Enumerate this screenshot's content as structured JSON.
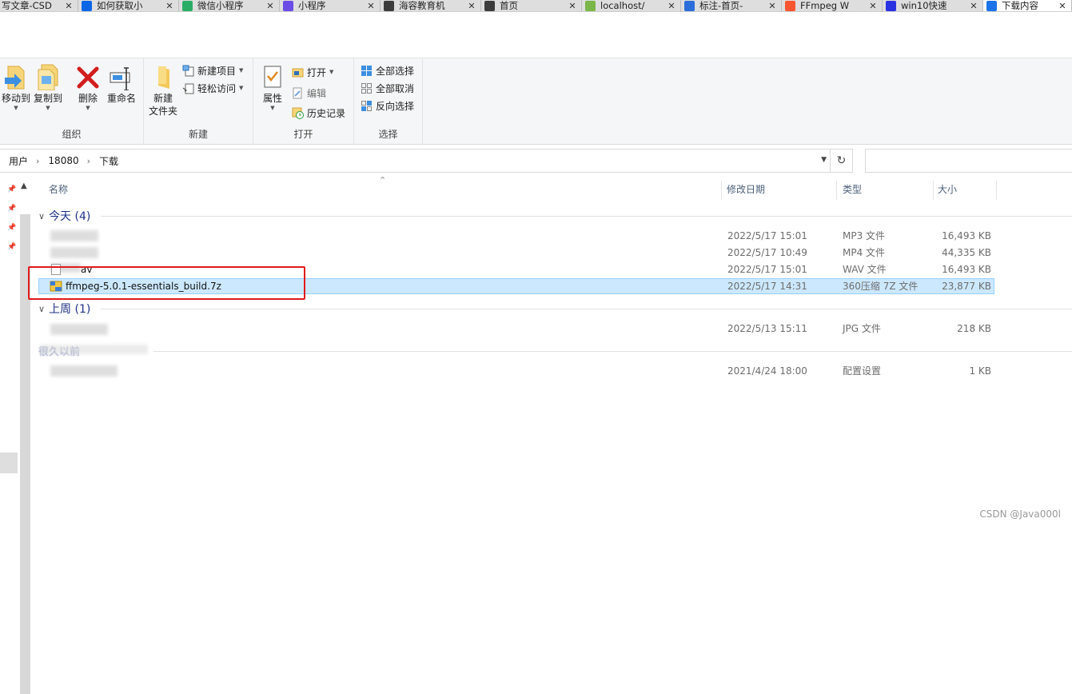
{
  "browser_tabs": [
    {
      "label": "写文章-CSD",
      "icon": "csdn-write-icon",
      "icon_color": "#c8c8c8"
    },
    {
      "label": "如何获取小",
      "icon": "zhihu-icon",
      "icon_color": "#0a66e4"
    },
    {
      "label": "微信小程序",
      "icon": "wechat-icon",
      "icon_color": "#2aae67"
    },
    {
      "label": "小程序",
      "icon": "miniprogram-icon",
      "icon_color": "#6b4ce6"
    },
    {
      "label": "海容教育机",
      "icon": "globe-icon",
      "icon_color": "#3c3c3c"
    },
    {
      "label": "首页",
      "icon": "globe-icon",
      "icon_color": "#3c3c3c"
    },
    {
      "label": "localhost/",
      "icon": "leaf-icon",
      "icon_color": "#7ab648"
    },
    {
      "label": "标注-首页-",
      "icon": "mark-icon",
      "icon_color": "#2b6ed9"
    },
    {
      "label": "FFmpeg W",
      "icon": "csdn-icon",
      "icon_color": "#fc5531"
    },
    {
      "label": "win10快速",
      "icon": "baidu-paw-icon",
      "icon_color": "#2932e1"
    },
    {
      "label": "下载内容",
      "icon": "download-icon",
      "icon_color": "#1a73e8",
      "active": true
    }
  ],
  "tab_close_glyph": "✕",
  "ribbon": {
    "organize": {
      "label": "组织",
      "move_to": "移动到",
      "copy_to": "复制到",
      "delete": "删除",
      "rename": "重命名"
    },
    "new": {
      "label": "新建",
      "new_folder_line1": "新建",
      "new_folder_line2": "文件夹",
      "new_item": "新建项目",
      "easy_access": "轻松访问"
    },
    "open": {
      "label": "打开",
      "properties": "属性",
      "open": "打开",
      "edit": "编辑",
      "history": "历史记录"
    },
    "select": {
      "label": "选择",
      "select_all": "全部选择",
      "select_none": "全部取消",
      "invert_selection": "反向选择"
    }
  },
  "address": {
    "crumbs": [
      "用户",
      "18080",
      "下载"
    ],
    "separator": "›"
  },
  "columns": {
    "name": "名称",
    "date": "修改日期",
    "type": "类型",
    "size": "大小"
  },
  "groups": [
    {
      "label": "今天 (4)"
    },
    {
      "label": "上周 (1)"
    }
  ],
  "rows": [
    {
      "name": "",
      "date": "2022/5/17 15:01",
      "type": "MP3 文件",
      "size": "16,493 KB"
    },
    {
      "name": "",
      "date": "2022/5/17 10:49",
      "type": "MP4 文件",
      "size": "44,335 KB"
    },
    {
      "name": "av",
      "date": "2022/5/17 15:01",
      "type": "WAV 文件",
      "size": "16,493 KB"
    },
    {
      "name": "ffmpeg-5.0.1-essentials_build.7z",
      "date": "2022/5/17 14:31",
      "type": "360压缩 7Z 文件",
      "size": "23,877 KB",
      "selected": true
    },
    {
      "name": "",
      "date": "2022/5/13 15:11",
      "type": "JPG 文件",
      "size": "218 KB"
    },
    {
      "name": "",
      "date": "2021/4/24 18:00",
      "type": "配置设置",
      "size": "1 KB"
    }
  ],
  "older_group_label": "很久以前",
  "watermark": "CSDN @Java000l",
  "colors": {
    "selection": "#cce8ff",
    "selection_border": "#99d1ff",
    "highlight_box": "#e01a1a",
    "group_text": "#1e3287"
  }
}
